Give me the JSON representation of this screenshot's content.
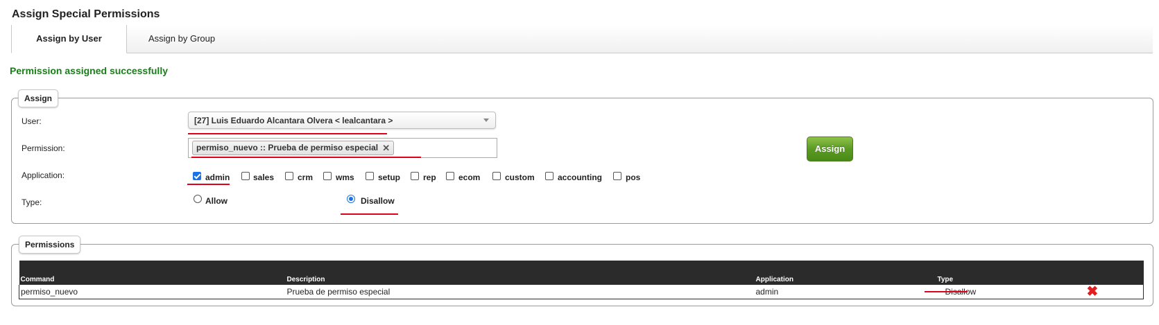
{
  "page_title": "Assign Special Permissions",
  "tabs": [
    {
      "label": "Assign by User",
      "active": true
    },
    {
      "label": "Assign by Group",
      "active": false
    }
  ],
  "status_message": "Permission assigned successfully",
  "assign_section": {
    "legend": "Assign",
    "user_label": "User:",
    "user_value": "[27] Luis Eduardo Alcantara Olvera < lealcantara >",
    "permission_label": "Permission:",
    "permission_chip": "permiso_nuevo :: Prueba de permiso especial",
    "application_label": "Application:",
    "applications": [
      {
        "label": "admin",
        "checked": true
      },
      {
        "label": "sales",
        "checked": false
      },
      {
        "label": "crm",
        "checked": false
      },
      {
        "label": "wms",
        "checked": false
      },
      {
        "label": "setup",
        "checked": false
      },
      {
        "label": "rep",
        "checked": false
      },
      {
        "label": "ecom",
        "checked": false
      },
      {
        "label": "custom",
        "checked": false
      },
      {
        "label": "accounting",
        "checked": false
      },
      {
        "label": "pos",
        "checked": false
      }
    ],
    "type_label": "Type:",
    "type_options": [
      {
        "label": "Allow",
        "selected": false
      },
      {
        "label": "Disallow",
        "selected": true
      }
    ],
    "assign_button": "Assign"
  },
  "permissions_section": {
    "legend": "Permissions",
    "columns": [
      "Command",
      "Description",
      "Application",
      "Type"
    ],
    "rows": [
      {
        "command": "permiso_nuevo",
        "description": "Prueba de permiso especial",
        "application": "admin",
        "type": "Disallow"
      }
    ]
  },
  "colors": {
    "success": "#1a7d1a",
    "accent": "#1a73e8",
    "button": "#5a9a24",
    "annotation": "#e0001b",
    "delete": "#e02020"
  },
  "icons": {
    "delete": "delete-icon",
    "dropdown": "chevron-down-icon"
  }
}
